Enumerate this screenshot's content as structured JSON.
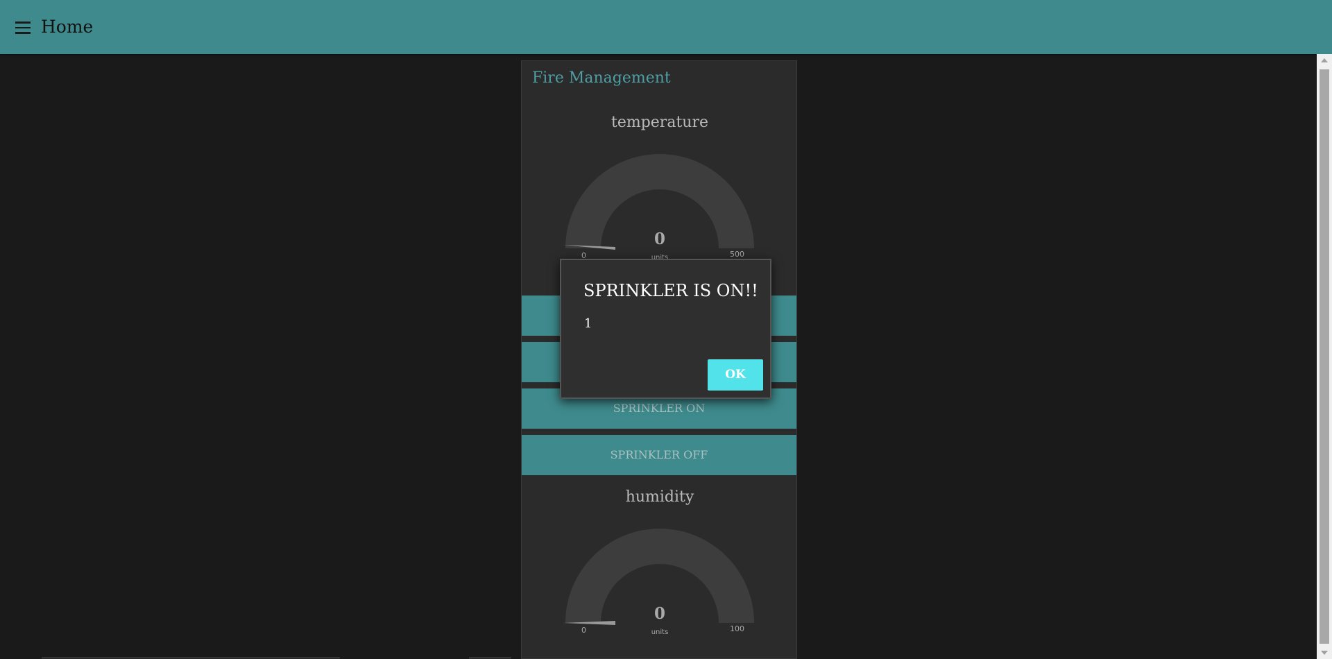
{
  "header": {
    "title": "Home",
    "menu_icon": "hamburger-menu-icon"
  },
  "group": {
    "title": "Fire Management"
  },
  "gauges": [
    {
      "label": "temperature",
      "value": "0",
      "units": "units",
      "min": "0",
      "max": "500"
    },
    {
      "label": "humidity",
      "value": "0",
      "units": "units",
      "min": "0",
      "max": "100"
    }
  ],
  "buttons": {
    "button_1": "",
    "button_2": "",
    "sprinkler_on": "SPRINKLER ON",
    "sprinkler_off": "SPRINKLER OFF"
  },
  "dialog": {
    "title": "SPRINKLER IS ON!!",
    "message": "1",
    "ok_label": "OK"
  },
  "colors": {
    "header_bg": "#3e8a8c",
    "page_bg": "#1a1a1a",
    "group_bg": "#2b2b2b",
    "group_title": "#4e9ea3",
    "button_bg": "#3e8a8c",
    "gauge_track": "#3d3d3d",
    "dialog_bg": "#2f2f2f",
    "ok_button": "#52e3ea"
  }
}
